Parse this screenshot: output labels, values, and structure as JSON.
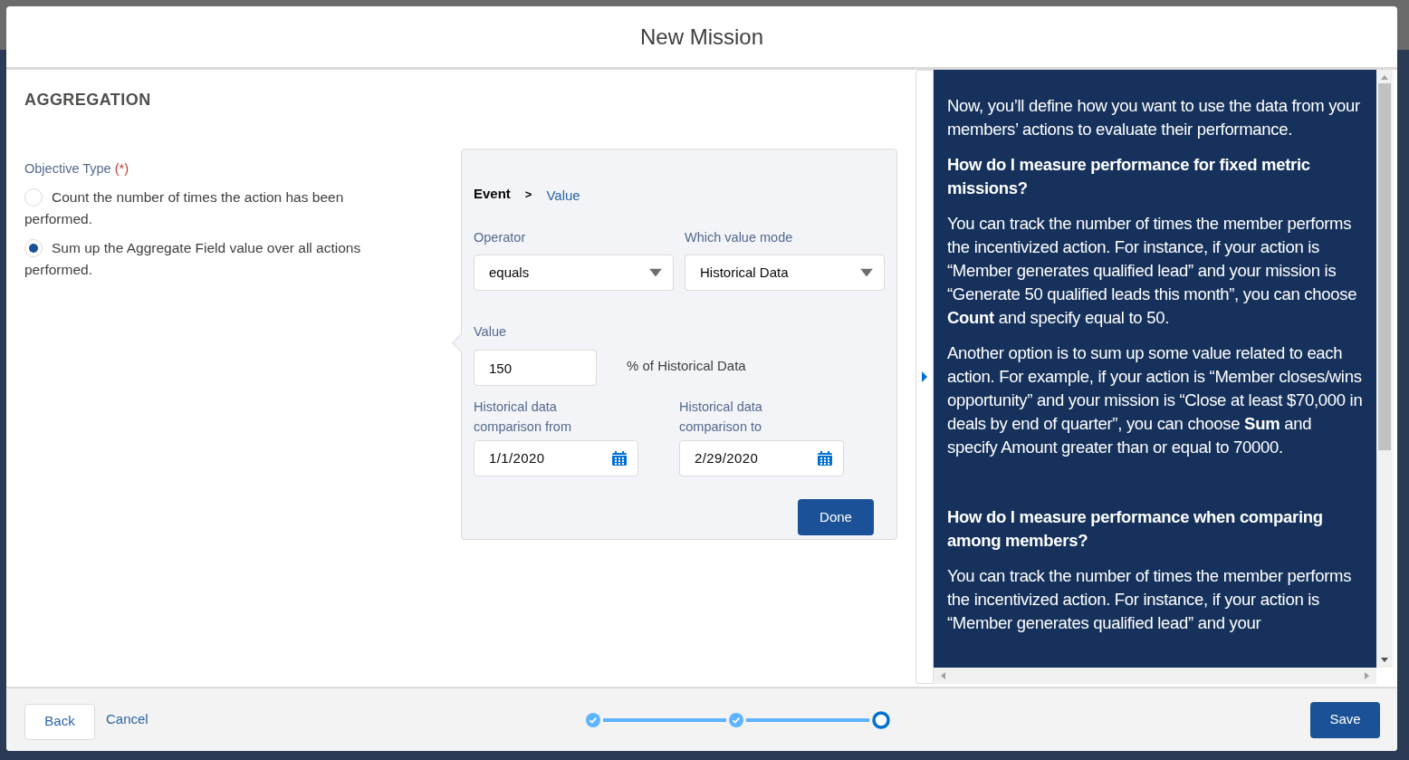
{
  "modal": {
    "title": "New Mission"
  },
  "section": {
    "title": "AGGREGATION"
  },
  "objective": {
    "label": "Objective Type",
    "required_mark": "(*)",
    "options": [
      {
        "label": "Count the number of times the action has been performed.",
        "selected": false
      },
      {
        "label": "Sum up the Aggregate Field value over all actions performed.",
        "selected": true
      }
    ]
  },
  "popover": {
    "breadcrumb": [
      {
        "label": "Event",
        "selected": true
      },
      {
        "label": "Value",
        "selected": false
      }
    ],
    "separator": ">",
    "operator": {
      "label": "Operator",
      "value": "equals"
    },
    "value_mode": {
      "label": "Which value mode",
      "value": "Historical Data"
    },
    "value": {
      "label": "Value",
      "value": "150",
      "suffix": "% of Historical Data"
    },
    "date_from": {
      "label": "Historical data comparison from",
      "value": "1/1/2020"
    },
    "date_to": {
      "label": "Historical data comparison to",
      "value": "2/29/2020"
    },
    "done": "Done"
  },
  "help": [
    {
      "kind": "paragraph",
      "text": "Now, you’ll define how you want to use the data from your members’ actions to evaluate their performance."
    },
    {
      "kind": "heading",
      "text": "How do I measure performance for fixed metric missions?"
    },
    {
      "kind": "paragraph",
      "text": "You can track the number of times the member performs the incentivized action. For instance, if your action is “Member generates qualified lead” and your mission is “Generate 50 qualified leads this month”, you can choose **Count** and specify equal to 50."
    },
    {
      "kind": "paragraph",
      "text": "Another option is to sum up some value related to each action. For example, if your action is “Member closes/wins opportunity” and your mission is “Close at least $70,000 in deals by end of quarter”, you can choose **Sum** and specify Amount greater than or equal to 70000."
    },
    {
      "kind": "spacer"
    },
    {
      "kind": "heading",
      "text": "How do I measure performance when comparing among members?"
    },
    {
      "kind": "paragraph",
      "text": "You can track the number of times the member performs the incentivized action. For instance, if your action is “Member generates qualified lead” and your"
    }
  ],
  "footer": {
    "back": "Back",
    "cancel": "Cancel",
    "save": "Save",
    "steps": [
      {
        "kind": "done"
      },
      {
        "kind": "done"
      },
      {
        "kind": "current"
      }
    ]
  }
}
